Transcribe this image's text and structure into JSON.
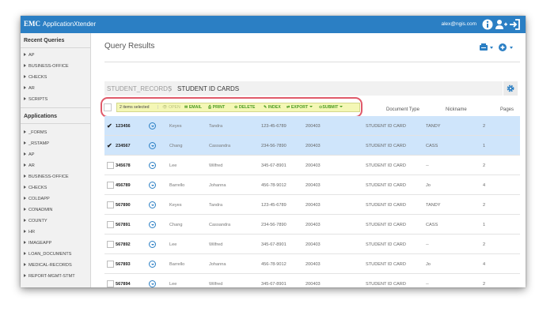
{
  "app": {
    "brand": "EMC",
    "name": "ApplicationXtender",
    "user_email": "alex@ngis.com",
    "accent_color": "#2b7fc4"
  },
  "sidebar": {
    "recent_title": "Recent Queries",
    "recent_items": [
      "AP",
      "BUSINESS-OFFICE",
      "CHECKS",
      "AR",
      "SCRIPTS"
    ],
    "applications_title": "Applications",
    "application_items": [
      "_FORMS",
      "_RSTAMP",
      "AP",
      "AR",
      "BUSINESS-OFFICE",
      "CHECKS",
      "COLDAPP",
      "CONADMIN",
      "COUNTY",
      "HR",
      "IMAGEAPP",
      "LOAN_DOCUMENTS",
      "MEDICAL-RECORDS",
      "REPORT-MGMT-STMT"
    ]
  },
  "main": {
    "title": "Query Results",
    "breadcrumb": [
      "STUDENT_RECORDS",
      "STUDENT ID CARDS"
    ],
    "breadcrumb_sep": "〉",
    "actions": {
      "selected": "2 items selected",
      "open": "OPEN",
      "email": "EMAIL",
      "print": "PRINT",
      "delete": "DELETE",
      "index": "INDEX",
      "export": "EXPORT",
      "submit": "SUBMIT"
    },
    "columns": [
      "Document Type",
      "Nickname",
      "Pages"
    ],
    "rows": [
      {
        "id": "123456",
        "last": "Keyes",
        "first": "Tandra",
        "ssn": "123-45-6789",
        "code": "200403",
        "doctype": "STUDENT ID CARD",
        "nickname": "TANDY",
        "pages": "2",
        "selected": true
      },
      {
        "id": "234567",
        "last": "Chang",
        "first": "Cassandra",
        "ssn": "234-56-7890",
        "code": "200403",
        "doctype": "STUDENT ID CARD",
        "nickname": "CASS",
        "pages": "1",
        "selected": true
      },
      {
        "id": "345678",
        "last": "Lee",
        "first": "Wilfred",
        "ssn": "345-67-8901",
        "code": "200403",
        "doctype": "STUDENT ID CARD",
        "nickname": "--",
        "pages": "2",
        "selected": false
      },
      {
        "id": "456789",
        "last": "Barrello",
        "first": "Johanna",
        "ssn": "456-78-9012",
        "code": "200403",
        "doctype": "STUDENT ID CARD",
        "nickname": "Jo",
        "pages": "4",
        "selected": false
      },
      {
        "id": "567890",
        "last": "Keyes",
        "first": "Tandra",
        "ssn": "123-45-6789",
        "code": "200403",
        "doctype": "STUDENT ID CARD",
        "nickname": "TANDY",
        "pages": "2",
        "selected": false
      },
      {
        "id": "567891",
        "last": "Chang",
        "first": "Cassandra",
        "ssn": "234-56-7890",
        "code": "200403",
        "doctype": "STUDENT ID CARD",
        "nickname": "CASS",
        "pages": "1",
        "selected": false
      },
      {
        "id": "567892",
        "last": "Lee",
        "first": "Wilfred",
        "ssn": "345-67-8901",
        "code": "200403",
        "doctype": "STUDENT ID CARD",
        "nickname": "--",
        "pages": "2",
        "selected": false
      },
      {
        "id": "567893",
        "last": "Barrello",
        "first": "Johanna",
        "ssn": "456-78-9012",
        "code": "200403",
        "doctype": "STUDENT ID CARD",
        "nickname": "Jo",
        "pages": "4",
        "selected": false
      },
      {
        "id": "567894",
        "last": "Lee",
        "first": "Wilfred",
        "ssn": "345-67-8901",
        "code": "200403",
        "doctype": "STUDENT ID CARD",
        "nickname": "--",
        "pages": "2",
        "selected": false
      }
    ]
  }
}
